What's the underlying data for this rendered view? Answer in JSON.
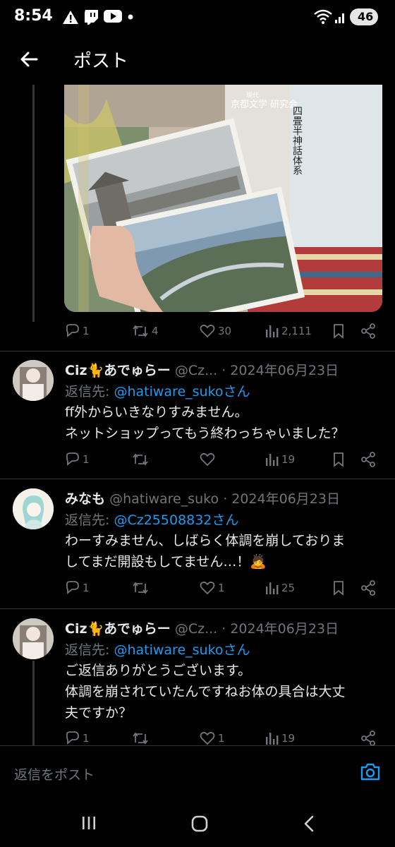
{
  "status": {
    "time": "8:54",
    "battery": "46"
  },
  "header": {
    "title": "ポスト"
  },
  "media": {
    "book_title_1": "京都文学\n研究会",
    "book_title_1_sub": "現代",
    "book_title_2": "四畳半神話体系"
  },
  "main_actions": {
    "replies": "1",
    "reposts": "4",
    "likes": "30",
    "views": "2,111"
  },
  "tweets": [
    {
      "display_name": "Ciz🐈あでゅらー",
      "handle": "@Cz...",
      "date": "· 2024年06月23日",
      "reply_prefix": "返信先: ",
      "reply_to": "@hatiware_sukoさん",
      "text": "ff外からいきなりすみません。\nネットショップってもう終わっちゃいました？",
      "replies": "1",
      "reposts": "",
      "likes": "",
      "views": "19"
    },
    {
      "display_name": "みなも",
      "handle": "@hatiware_suko",
      "date": "· 2024年06月23日",
      "reply_prefix": "返信先: ",
      "reply_to": "@Cz25508832さん",
      "text": "わーすみません、しばらく体調を崩しておりま\nしてまだ開設もしてません…！🙇",
      "replies": "1",
      "reposts": "",
      "likes": "1",
      "views": "25"
    },
    {
      "display_name": "Ciz🐈あでゅらー",
      "handle": "@Cz...",
      "date": "· 2024年06月23日",
      "reply_prefix": "返信先: ",
      "reply_to": "@hatiware_sukoさん",
      "text": "ご返信ありがとうございます。\n体調を崩されていたんですねお体の具合は大丈\n夫ですか？",
      "replies": "1",
      "reposts": "",
      "likes": "1",
      "views": "19"
    }
  ],
  "composer": {
    "placeholder": "返信をポスト"
  },
  "icons": {
    "back": "arrow-left-icon",
    "reply": "speech-bubble-icon",
    "repost": "repost-arrows-icon",
    "like": "heart-icon",
    "views": "bar-chart-icon",
    "bookmark": "bookmark-icon",
    "share": "share-icon",
    "camera": "camera-icon"
  },
  "colors": {
    "accent": "#1d9bf0",
    "muted": "#71767b",
    "background": "#000000"
  }
}
